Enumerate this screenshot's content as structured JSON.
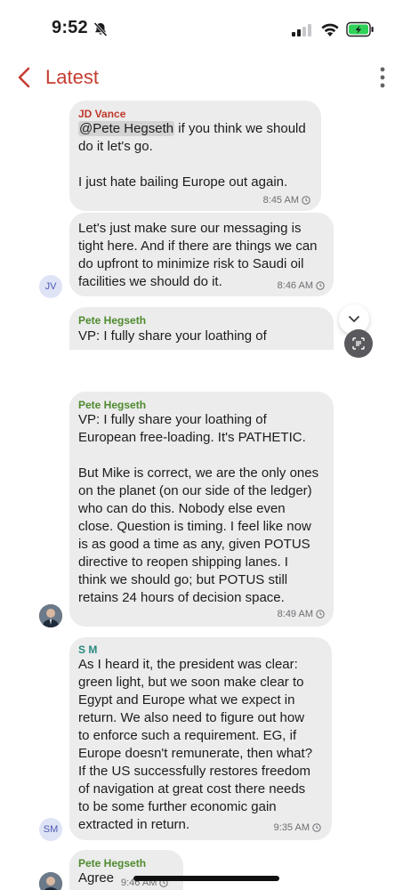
{
  "status_bar": {
    "time": "9:52"
  },
  "header": {
    "title": "Latest"
  },
  "messages": [
    {
      "sender": "JD Vance",
      "mention": "@Pete Hegseth",
      "text_after_mention": " if you think we should\ndo it let's go.\n\nI just hate bailing Europe out again.",
      "time": "8:45 AM"
    },
    {
      "text": "Let's just make sure our messaging is\ntight here. And if there are things we can\ndo upfront to minimize risk to Saudi oil\nfacilities we should do it.",
      "time": "8:46 AM",
      "avatar": "JV"
    },
    {
      "sender": "Pete Hegseth",
      "text": "VP: I fully share your loathing of"
    },
    {
      "sender": "Pete Hegseth",
      "text": "VP: I fully share your loathing of\nEuropean free-loading. It's PATHETIC.\n\nBut Mike is correct, we are the only ones\non the planet (on our side of the ledger)\nwho can do this. Nobody else even\nclose. Question is timing. I feel like now\nis as good a time as any, given POTUS\ndirective to reopen shipping lanes. I\nthink we should go; but POTUS still\nretains 24 hours of decision space.",
      "time": "8:49 AM"
    },
    {
      "sender": "S M",
      "text": "As I heard it, the president was clear:\ngreen light, but we soon make clear to\nEgypt and Europe what we expect in\nreturn. We also need to figure out how\nto enforce such a requirement. EG, if\nEurope doesn't remunerate, then what?\nIf the US successfully restores freedom\nof navigation at great cost there needs\nto be some further economic gain\nextracted in return.",
      "time": "9:35 AM",
      "avatar": "SM"
    },
    {
      "sender": "Pete Hegseth",
      "text": "Agree",
      "time": "9:46 AM"
    }
  ],
  "colors": {
    "accent": "#c63c32",
    "jd_vance_name": "#c0392b",
    "pete_hegseth_name": "#4e8a2e",
    "sm_name": "#2a8a80",
    "bubble": "#ececec"
  }
}
